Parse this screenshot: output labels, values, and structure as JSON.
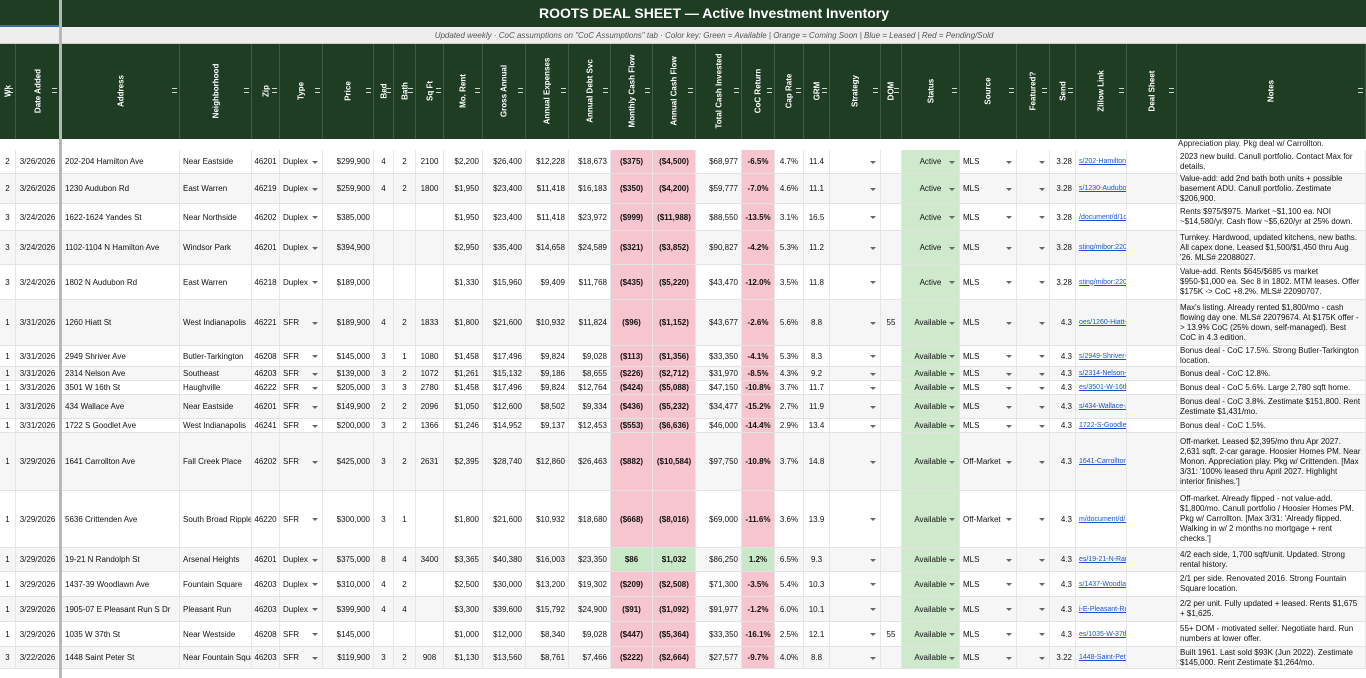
{
  "title": "ROOTS DEAL SHEET — Active Investment Inventory",
  "subtitle": "Updated weekly  ·  CoC assumptions on \"CoC Assumptions\" tab  ·  Color key: Green = Available  |  Orange = Coming Soon  |  Blue = Leased  |  Red = Pending/Sold",
  "colors": {
    "header_bg": "#1e3d23",
    "available": "#cfe9cd",
    "negative": "#f7c5cf",
    "positive": "#c9e8c7",
    "link": "#1a56c9"
  },
  "headers": [
    "Wk",
    "Date Added",
    "Address",
    "Neighborhood",
    "Zip",
    "Type",
    "Price",
    "Bed",
    "Bath",
    "Sq Ft",
    "Mo. Rent",
    "Gross Annual",
    "Annual Expenses",
    "Annual Debt Svc",
    "Monthly Cash Flow",
    "Annual Cash Flow",
    "Total Cash Invested",
    "CoC Return",
    "Cap Rate",
    "GRM",
    "Strategy",
    "DOM",
    "Status",
    "Source",
    "Featured?",
    "Send",
    "Zillow Link",
    "Deal Sheet",
    "Notes"
  ],
  "top_partial_note": "Appreciation play. Pkg deal w/ Carrollton.",
  "rows": [
    {
      "wk": "2",
      "date": "3/26/2026",
      "address": "202-204 Hamilton Ave",
      "neighborhood": "Near Eastside",
      "zip": "46201",
      "type": "Duplex",
      "price": "$299,900",
      "bed": "4",
      "bath": "2",
      "sqft": "2100",
      "rent": "$2,200",
      "gross": "$26,400",
      "expenses": "$12,228",
      "debt": "$18,673",
      "mcf": "($375)",
      "acf": "($4,500)",
      "cash": "$68,977",
      "coc": "-6.5%",
      "cap": "4.7%",
      "grm": "11.4",
      "strategy": "",
      "dom": "",
      "status": "Active",
      "source": "MLS",
      "featured": "",
      "send": "3.28",
      "zillow": "s/202-Hamilton-Ave-Indianapolis-IN",
      "deal": "",
      "notes": "2023 new build. Canull portfolio. Contact Max for details."
    },
    {
      "wk": "2",
      "date": "3/26/2026",
      "address": "1230 Audubon Rd",
      "neighborhood": "East Warren",
      "zip": "46219",
      "type": "Duplex",
      "price": "$259,900",
      "bed": "4",
      "bath": "2",
      "sqft": "1800",
      "rent": "$1,950",
      "gross": "$23,400",
      "expenses": "$11,418",
      "debt": "$16,183",
      "mcf": "($350)",
      "acf": "($4,200)",
      "cash": "$59,777",
      "coc": "-7.0%",
      "cap": "4.6%",
      "grm": "11.1",
      "strategy": "",
      "dom": "",
      "status": "Active",
      "source": "MLS",
      "featured": "",
      "send": "3.28",
      "zillow": "s/1230-Audubon-Rd-Indianapolis-IN",
      "deal": "",
      "notes": "Value-add: add 2nd bath both units + possible basement ADU. Canull portfolio. Zestimate $206,900."
    },
    {
      "wk": "3",
      "date": "3/24/2026",
      "address": "1622-1624 Yandes St",
      "neighborhood": "Near Northside",
      "zip": "46202",
      "type": "Duplex",
      "price": "$385,000",
      "bed": "",
      "bath": "",
      "sqft": "",
      "rent": "$1,950",
      "gross": "$23,400",
      "expenses": "$11,418",
      "debt": "$23,972",
      "mcf": "($999)",
      "acf": "($11,988)",
      "cash": "$88,550",
      "coc": "-13.5%",
      "cap": "3.1%",
      "grm": "16.5",
      "strategy": "",
      "dom": "",
      "status": "Active",
      "source": "MLS",
      "featured": "",
      "send": "3.28",
      "zillow": "/document/d/1dsKAnOxYF5OTOp",
      "deal": "",
      "notes": "Rents $975/$975. Market ~$1,100 ea. NOI ~$14,580/yr. Cash flow ~$5,620/yr at 25% down."
    },
    {
      "wk": "3",
      "date": "3/24/2026",
      "address": "1102-1104 N Hamilton Ave",
      "neighborhood": "Windsor Park",
      "zip": "46201",
      "type": "Duplex",
      "price": "$394,900",
      "bed": "",
      "bath": "",
      "sqft": "",
      "rent": "$2,950",
      "gross": "$35,400",
      "expenses": "$14,658",
      "debt": "$24,589",
      "mcf": "($321)",
      "acf": "($3,852)",
      "cash": "$90,827",
      "coc": "-4.2%",
      "cap": "5.3%",
      "grm": "11.2",
      "strategy": "",
      "dom": "",
      "status": "Active",
      "source": "MLS",
      "featured": "",
      "send": "3.28",
      "zillow": "sting/mibor:22088l-5cu8tn27Ybye",
      "deal": "",
      "notes": "Turnkey. Hardwood, updated kitchens, new baths. All capex done. Leased $1,500/$1,450 thru Aug '26. MLS# 22088027."
    },
    {
      "wk": "3",
      "date": "3/24/2026",
      "address": "1802 N Audubon Rd",
      "neighborhood": "East Warren",
      "zip": "46218",
      "type": "Duplex",
      "price": "$189,000",
      "bed": "",
      "bath": "",
      "sqft": "",
      "rent": "$1,330",
      "gross": "$15,960",
      "expenses": "$9,409",
      "debt": "$11,768",
      "mcf": "($435)",
      "acf": "($5,220)",
      "cash": "$43,470",
      "coc": "-12.0%",
      "cap": "3.5%",
      "grm": "11.8",
      "strategy": "",
      "dom": "",
      "status": "Active",
      "source": "MLS",
      "featured": "",
      "send": "3.28",
      "zillow": "sting/mibor:22090eANI9Ae9dqDPe",
      "deal": "",
      "notes": "Value-add. Rents $645/$685 vs market $950-$1,000 ea. Sec 8 in 1802. MTM leases. Offer $175K -> CoC +8.2%. MLS# 22090707."
    },
    {
      "wk": "1",
      "date": "3/31/2026",
      "address": "1260 Hiatt St",
      "neighborhood": "West Indianapolis",
      "zip": "46221",
      "type": "SFR",
      "price": "$189,900",
      "bed": "4",
      "bath": "2",
      "sqft": "1833",
      "rent": "$1,800",
      "gross": "$21,600",
      "expenses": "$10,932",
      "debt": "$11,824",
      "mcf": "($96)",
      "acf": "($1,152)",
      "cash": "$43,677",
      "coc": "-2.6%",
      "cap": "5.6%",
      "grm": "8.8",
      "strategy": "",
      "dom": "55",
      "status": "Available",
      "source": "MLS",
      "featured": "",
      "send": "4.3",
      "zillow": "oes/1260-Hiatt-St-XT2uTJM-g1hg8",
      "deal": "",
      "notes": "Max's listing. Already rented $1,800/mo - cash flowing day one. MLS# 22079674. At $175K offer -> 13.9% CoC (25% down, self-managed). Best CoC in 4.3 edition."
    },
    {
      "wk": "1",
      "date": "3/31/2026",
      "address": "2949 Shriver Ave",
      "neighborhood": "Butler-Tarkington",
      "zip": "46208",
      "type": "SFR",
      "price": "$145,000",
      "bed": "3",
      "bath": "1",
      "sqft": "1080",
      "rent": "$1,458",
      "gross": "$17,496",
      "expenses": "$9,824",
      "debt": "$9,028",
      "mcf": "($113)",
      "acf": "($1,356)",
      "cash": "$33,350",
      "coc": "-4.1%",
      "cap": "5.3%",
      "grm": "8.3",
      "strategy": "",
      "dom": "",
      "status": "Available",
      "source": "MLS",
      "featured": "",
      "send": "4.3",
      "zillow": "s/2949-Shriver-Ave-Indianapolis-IN",
      "deal": "",
      "notes": "Bonus deal - CoC 17.5%. Strong Butler-Tarkington location."
    },
    {
      "wk": "1",
      "date": "3/31/2026",
      "address": "2314 Nelson Ave",
      "neighborhood": "Southeast",
      "zip": "46203",
      "type": "SFR",
      "price": "$139,000",
      "bed": "3",
      "bath": "2",
      "sqft": "1072",
      "rent": "$1,261",
      "gross": "$15,132",
      "expenses": "$9,186",
      "debt": "$8,655",
      "mcf": "($226)",
      "acf": "($2,712)",
      "cash": "$31,970",
      "coc": "-8.5%",
      "cap": "4.3%",
      "grm": "9.2",
      "strategy": "",
      "dom": "",
      "status": "Available",
      "source": "MLS",
      "featured": "",
      "send": "4.3",
      "zillow": "s/2314-Nelson-Ave-Indianapolis-IN",
      "deal": "",
      "notes": "Bonus deal - CoC 12.8%."
    },
    {
      "wk": "1",
      "date": "3/31/2026",
      "address": "3501 W 16th St",
      "neighborhood": "Haughville",
      "zip": "46222",
      "type": "SFR",
      "price": "$205,000",
      "bed": "3",
      "bath": "3",
      "sqft": "2780",
      "rent": "$1,458",
      "gross": "$17,496",
      "expenses": "$9,824",
      "debt": "$12,764",
      "mcf": "($424)",
      "acf": "($5,088)",
      "cash": "$47,150",
      "coc": "-10.8%",
      "cap": "3.7%",
      "grm": "11.7",
      "strategy": "",
      "dom": "",
      "status": "Available",
      "source": "MLS",
      "featured": "",
      "send": "4.3",
      "zillow": "es/3501-W-16th-St-Indianapolis-IN-",
      "deal": "",
      "notes": "Bonus deal - CoC 5.6%. Large 2,780 sqft home."
    },
    {
      "wk": "1",
      "date": "3/31/2026",
      "address": "434 Wallace Ave",
      "neighborhood": "Near Eastside",
      "zip": "46201",
      "type": "SFR",
      "price": "$149,900",
      "bed": "2",
      "bath": "2",
      "sqft": "2096",
      "rent": "$1,050",
      "gross": "$12,600",
      "expenses": "$8,502",
      "debt": "$9,334",
      "mcf": "($436)",
      "acf": "($5,232)",
      "cash": "$34,477",
      "coc": "-15.2%",
      "cap": "2.7%",
      "grm": "11.9",
      "strategy": "",
      "dom": "",
      "status": "Available",
      "source": "MLS",
      "featured": "",
      "send": "4.3",
      "zillow": "s/434-Wallace-Ave-Indianapolis-IN",
      "deal": "",
      "notes": "Bonus deal - CoC 3.8%. Zestimate $151,800. Rent Zestimate $1,431/mo."
    },
    {
      "wk": "1",
      "date": "3/31/2026",
      "address": "1722 S Goodlet Ave",
      "neighborhood": "West Indianapolis",
      "zip": "46241",
      "type": "SFR",
      "price": "$200,000",
      "bed": "3",
      "bath": "2",
      "sqft": "1366",
      "rent": "$1,246",
      "gross": "$14,952",
      "expenses": "$9,137",
      "debt": "$12,453",
      "mcf": "($553)",
      "acf": "($6,636)",
      "cash": "$46,000",
      "coc": "-14.4%",
      "cap": "2.9%",
      "grm": "13.4",
      "strategy": "",
      "dom": "",
      "status": "Available",
      "source": "MLS",
      "featured": "",
      "send": "4.3",
      "zillow": "1722-S-Goodlet-Ave-Indianapolis-I",
      "deal": "",
      "notes": "Bonus deal - CoC 1.5%."
    },
    {
      "wk": "1",
      "date": "3/29/2026",
      "address": "1641 Carrollton Ave",
      "neighborhood": "Fall Creek Place",
      "zip": "46202",
      "type": "SFR",
      "price": "$425,000",
      "bed": "3",
      "bath": "2",
      "sqft": "2631",
      "rent": "$2,395",
      "gross": "$28,740",
      "expenses": "$12,860",
      "debt": "$26,463",
      "mcf": "($882)",
      "acf": "($10,584)",
      "cash": "$97,750",
      "coc": "-10.8%",
      "cap": "3.7%",
      "grm": "14.8",
      "strategy": "",
      "dom": "",
      "status": "Available",
      "source": "Off-Market",
      "featured": "",
      "send": "4.3",
      "zillow": "1641-Carrollton-AQBMyohxbAUAR",
      "deal": "",
      "notes": "Off-market. Leased $2,395/mo thru Apr 2027. 2,631 sqft. 2-car garage. Hoosier Homes PM. Near Monon. Appreciation play. Pkg w/ Crittenden. [Max 3/31: '100% leased thru April 2027. Highlight interior finishes.']"
    },
    {
      "wk": "1",
      "date": "3/29/2026",
      "address": "5636 Crittenden Ave",
      "neighborhood": "South Broad Ripple",
      "zip": "46220",
      "type": "SFR",
      "price": "$300,000",
      "bed": "3",
      "bath": "1",
      "sqft": "",
      "rent": "$1,800",
      "gross": "$21,600",
      "expenses": "$10,932",
      "debt": "$18,680",
      "mcf": "($668)",
      "acf": "($8,016)",
      "cash": "$69,000",
      "coc": "-11.6%",
      "cap": "3.6%",
      "grm": "13.9",
      "strategy": "",
      "dom": "",
      "status": "Available",
      "source": "Off-Market",
      "featured": "",
      "send": "4.3",
      "zillow": "m/document/d/1ov_ltv68pH7rc6V9t",
      "deal": "",
      "notes": "Off-market. Already flipped - not value-add. $1,800/mo. Canull portfolio / Hoosier Homes PM. Pkg w/ Carrollton. [Max 3/31: 'Already flipped. Walking in w/ 2 months no mortgage + rent checks.']"
    },
    {
      "wk": "1",
      "date": "3/29/2026",
      "address": "19-21 N Randolph St",
      "neighborhood": "Arsenal Heights",
      "zip": "46201",
      "type": "Duplex",
      "price": "$375,000",
      "bed": "8",
      "bath": "4",
      "sqft": "3400",
      "rent": "$3,365",
      "gross": "$40,380",
      "expenses": "$16,003",
      "debt": "$23,350",
      "mcf": "$86",
      "acf": "$1,032",
      "cash": "$86,250",
      "coc": "1.2%",
      "cap": "6.5%",
      "grm": "9.3",
      "strategy": "",
      "dom": "",
      "status": "Available",
      "source": "MLS",
      "featured": "",
      "send": "4.3",
      "zillow": "es/19-21-N-Randolph-St-Indianapo",
      "deal": "",
      "notes": "4/2 each side, 1,700 sqft/unit. Updated. Strong rental history."
    },
    {
      "wk": "1",
      "date": "3/29/2026",
      "address": "1437-39 Woodlawn Ave",
      "neighborhood": "Fountain Square",
      "zip": "46203",
      "type": "Duplex",
      "price": "$310,000",
      "bed": "4",
      "bath": "2",
      "sqft": "",
      "rent": "$2,500",
      "gross": "$30,000",
      "expenses": "$13,200",
      "debt": "$19,302",
      "mcf": "($209)",
      "acf": "($2,508)",
      "cash": "$71,300",
      "coc": "-3.5%",
      "cap": "5.4%",
      "grm": "10.3",
      "strategy": "",
      "dom": "",
      "status": "Available",
      "source": "MLS",
      "featured": "",
      "send": "4.3",
      "zillow": "s/1437-Woodlawn-Ave-Indianapolis",
      "deal": "",
      "notes": "2/1 per side. Renovated 2016. Strong Fountain Square location."
    },
    {
      "wk": "1",
      "date": "3/29/2026",
      "address": "1905-07 E Pleasant Run S Dr",
      "neighborhood": "Pleasant Run",
      "zip": "46203",
      "type": "Duplex",
      "price": "$399,900",
      "bed": "4",
      "bath": "4",
      "sqft": "",
      "rent": "$3,300",
      "gross": "$39,600",
      "expenses": "$15,792",
      "debt": "$24,900",
      "mcf": "($91)",
      "acf": "($1,092)",
      "cash": "$91,977",
      "coc": "-1.2%",
      "cap": "6.0%",
      "grm": "10.1",
      "strategy": "",
      "dom": "",
      "status": "Available",
      "source": "MLS",
      "featured": "",
      "send": "4.3",
      "zillow": "i-E-Pleasant-Run-Parkway-S-Dr-Ir",
      "deal": "",
      "notes": "2/2 per unit. Fully updated + leased. Rents $1,675 + $1,625."
    },
    {
      "wk": "1",
      "date": "3/29/2026",
      "address": "1035 W 37th St",
      "neighborhood": "Near Westside",
      "zip": "46208",
      "type": "SFR",
      "price": "$145,000",
      "bed": "",
      "bath": "",
      "sqft": "",
      "rent": "$1,000",
      "gross": "$12,000",
      "expenses": "$8,340",
      "debt": "$9,028",
      "mcf": "($447)",
      "acf": "($5,364)",
      "cash": "$33,350",
      "coc": "-16.1%",
      "cap": "2.5%",
      "grm": "12.1",
      "strategy": "",
      "dom": "55",
      "status": "Available",
      "source": "MLS",
      "featured": "",
      "send": "4.3",
      "zillow": "es/1035-W-37th-St-Indianapolis-IN-",
      "deal": "",
      "notes": "55+ DOM - motivated seller. Negotiate hard. Run numbers at lower offer."
    },
    {
      "wk": "3",
      "date": "3/22/2026",
      "address": "1448 Saint Peter St",
      "neighborhood": "Near Fountain Square",
      "zip": "46203",
      "type": "SFR",
      "price": "$119,900",
      "bed": "3",
      "bath": "2",
      "sqft": "908",
      "rent": "$1,130",
      "gross": "$13,560",
      "expenses": "$8,761",
      "debt": "$7,466",
      "mcf": "($222)",
      "acf": "($2,664)",
      "cash": "$27,577",
      "coc": "-9.7%",
      "cap": "4.0%",
      "grm": "8.8",
      "strategy": "",
      "dom": "",
      "status": "Available",
      "source": "MLS",
      "featured": "",
      "send": "3.22",
      "zillow": "1448-Saint-Peter-St-Indianapolis-I",
      "deal": "",
      "notes": "Built 1961. Last sold $93K (Jun 2022). Zestimate $145,000. Rent Zestimate $1,264/mo."
    }
  ]
}
